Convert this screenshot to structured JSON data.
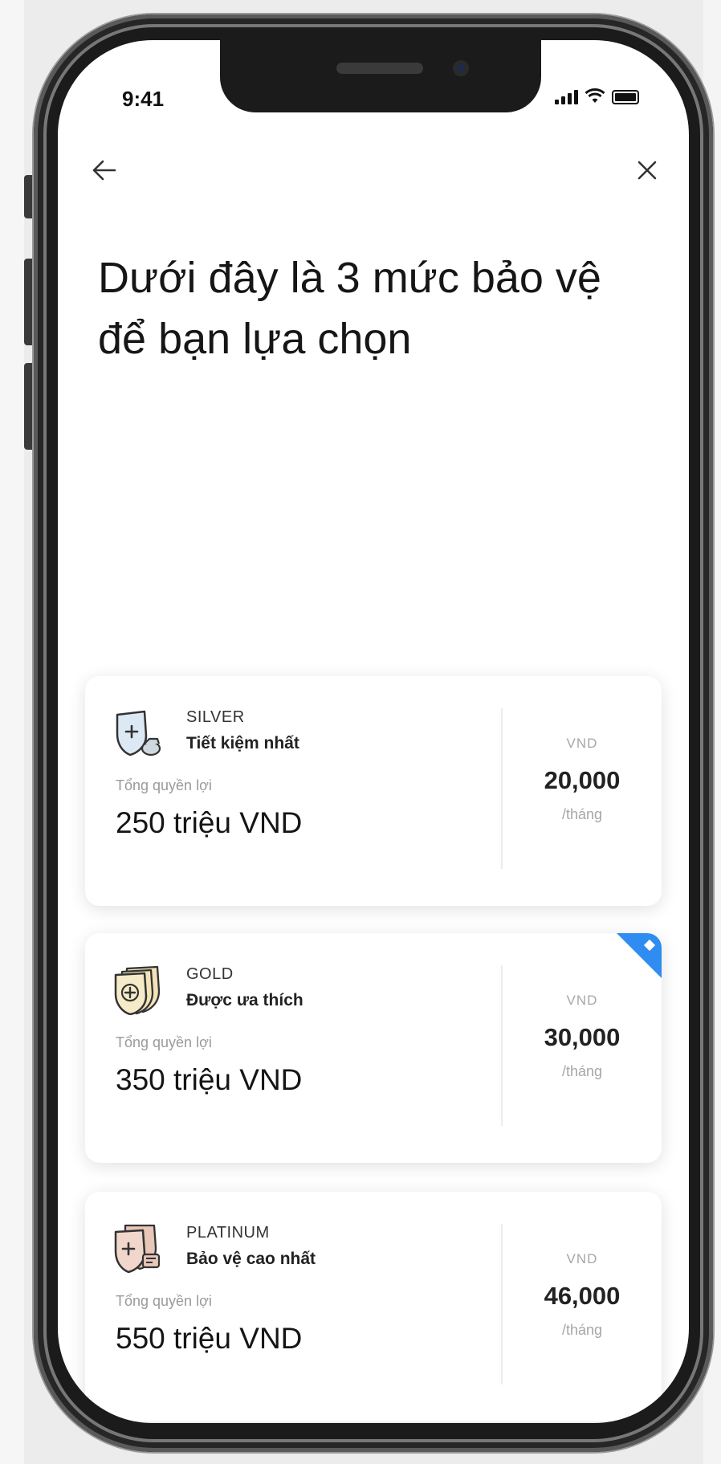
{
  "status_bar": {
    "time": "9:41"
  },
  "header": {
    "back_icon": "arrow-left-icon",
    "close_icon": "close-icon"
  },
  "heading": {
    "line1": "Dưới đây là 3 mức bảo vệ",
    "line2": "để bạn lựa chọn"
  },
  "plans": [
    {
      "tier": "SILVER",
      "tagline": "Tiết kiệm nhất",
      "benefit_label": "Tổng quyền lợi",
      "benefit_value": "250 triệu VND",
      "currency": "VND",
      "price": "20,000",
      "period": "/tháng",
      "icon": "shield-plus-icon",
      "featured": false
    },
    {
      "tier": "GOLD",
      "tagline": "Được ưa thích",
      "benefit_label": "Tổng quyền lợi",
      "benefit_value": "350 triệu VND",
      "currency": "VND",
      "price": "30,000",
      "period": "/tháng",
      "icon": "shield-plus-icon",
      "featured": true
    },
    {
      "tier": "PLATINUM",
      "tagline": "Bảo vệ cao nhất",
      "benefit_label": "Tổng quyền lợi",
      "benefit_value": "550 triệu VND",
      "currency": "VND",
      "price": "46,000",
      "period": "/tháng",
      "icon": "shield-plus-icon",
      "featured": false
    }
  ],
  "colors": {
    "silver": "#dde8f5",
    "gold": "#f2e3b8",
    "platinum": "#e8c6b8",
    "accent": "#2f8cf0"
  }
}
